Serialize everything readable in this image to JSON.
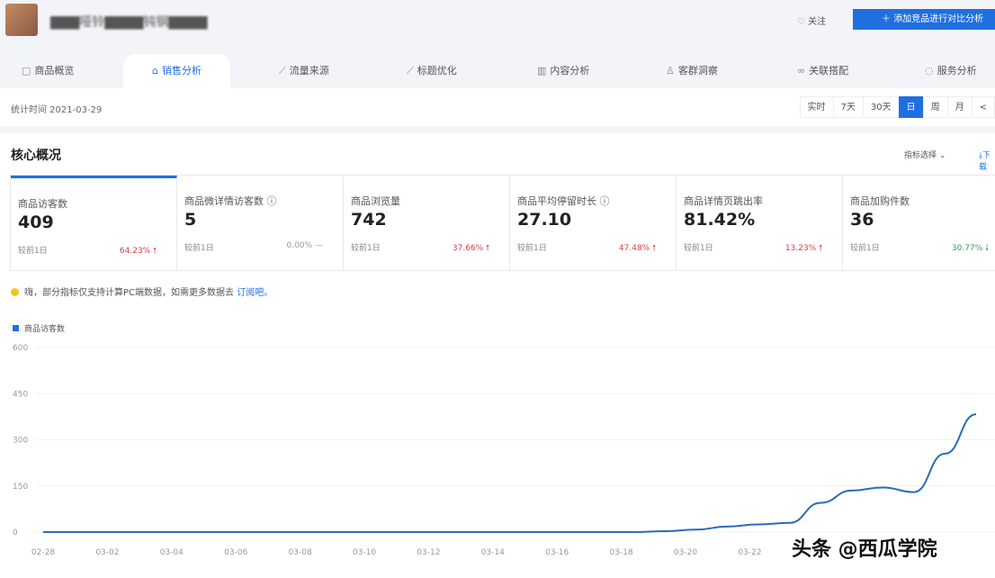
{
  "header": {
    "product_title": "▇▇▇哑铃▇▇▇▇钝钢▇▇▇▇",
    "follow": "关注",
    "compare_button": "添加竞品进行对比分析"
  },
  "tabs": [
    {
      "label": "商品概览",
      "icon": "box-icon"
    },
    {
      "label": "销售分析",
      "icon": "bag-icon"
    },
    {
      "label": "流量来源",
      "icon": "chart-icon"
    },
    {
      "label": "标题优化",
      "icon": "chart-icon"
    },
    {
      "label": "内容分析",
      "icon": "doc-icon"
    },
    {
      "label": "客群洞察",
      "icon": "user-icon"
    },
    {
      "label": "关联搭配",
      "icon": "link-icon"
    },
    {
      "label": "服务分析",
      "icon": "service-icon"
    }
  ],
  "stat_time": "统计时间 2021-03-29",
  "range_buttons": [
    "实时",
    "7天",
    "30天",
    "日",
    "周",
    "月",
    "<"
  ],
  "core": {
    "title": "核心概况",
    "metric_select": "指标选择",
    "download": "下载"
  },
  "cards": [
    {
      "label": "商品访客数",
      "value": "409",
      "compare": "较前1日",
      "pct": "64.23%",
      "trend": "up"
    },
    {
      "label": "商品微详情访客数 ⓘ",
      "value": "5",
      "compare": "较前1日",
      "pct": "0.00%",
      "trend": "flat"
    },
    {
      "label": "商品浏览量",
      "value": "742",
      "compare": "较前1日",
      "pct": "37.66%",
      "trend": "up"
    },
    {
      "label": "商品平均停留时长 ⓘ",
      "value": "27.10",
      "compare": "较前1日",
      "pct": "47.48%",
      "trend": "up"
    },
    {
      "label": "商品详情页跳出率",
      "value": "81.42%",
      "compare": "较前1日",
      "pct": "13.23%",
      "trend": "up"
    },
    {
      "label": "商品加购件数",
      "value": "36",
      "compare": "较前1日",
      "pct": "30.77%",
      "trend": "down"
    }
  ],
  "notice": {
    "text": "嗨，部分指标仅支持计算PC端数据，如需更多数据去",
    "link": "订阅吧。"
  },
  "watermark": "头条 @西瓜学院",
  "chart_data": {
    "type": "line",
    "series": [
      {
        "name": "商品访客数",
        "color": "#1f6fe0",
        "values": [
          0,
          0,
          0,
          0,
          0,
          0,
          0,
          0,
          0,
          0,
          0,
          0,
          0,
          0,
          0,
          0,
          0,
          0,
          0,
          0,
          3,
          8,
          18,
          25,
          30,
          95,
          135,
          145,
          130,
          255,
          383
        ]
      }
    ],
    "x": [
      "02-28",
      "03-01",
      "03-02",
      "03-03",
      "03-04",
      "03-05",
      "03-06",
      "03-07",
      "03-08",
      "03-09",
      "03-10",
      "03-11",
      "03-12",
      "03-13",
      "03-14",
      "03-15",
      "03-16",
      "03-17",
      "03-18",
      "03-19",
      "03-20",
      "03-21",
      "03-22",
      "03-23",
      "03-24",
      "03-25",
      "03-26",
      "03-27",
      "03-28",
      "03-29",
      "03-29"
    ],
    "x_ticks": [
      "02-28",
      "03-02",
      "03-04",
      "03-06",
      "03-08",
      "03-10",
      "03-12",
      "03-14",
      "03-16",
      "03-18",
      "03-20",
      "03-22"
    ],
    "y_ticks": [
      "0",
      "150",
      "300",
      "450",
      "600"
    ],
    "ylim": [
      0,
      600
    ]
  }
}
